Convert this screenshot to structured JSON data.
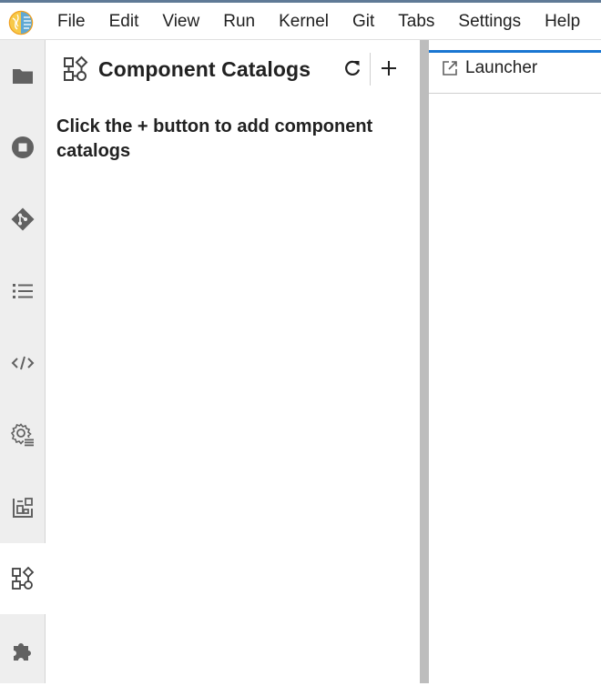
{
  "menu": {
    "items": [
      {
        "name": "menu-file",
        "label": "File"
      },
      {
        "name": "menu-edit",
        "label": "Edit"
      },
      {
        "name": "menu-view",
        "label": "View"
      },
      {
        "name": "menu-run",
        "label": "Run"
      },
      {
        "name": "menu-kernel",
        "label": "Kernel"
      },
      {
        "name": "menu-git",
        "label": "Git"
      },
      {
        "name": "menu-tabs",
        "label": "Tabs"
      },
      {
        "name": "menu-settings",
        "label": "Settings"
      },
      {
        "name": "menu-help",
        "label": "Help"
      }
    ]
  },
  "sidebar": {
    "items": [
      {
        "icon": "folder-icon",
        "active": false
      },
      {
        "icon": "stop-circle-icon",
        "active": false
      },
      {
        "icon": "git-icon",
        "active": false
      },
      {
        "icon": "list-icon",
        "active": false
      },
      {
        "icon": "code-icon",
        "active": false
      },
      {
        "icon": "runtime-settings-icon",
        "active": false
      },
      {
        "icon": "component-palette-icon",
        "active": false
      },
      {
        "icon": "component-catalogs-icon",
        "active": true
      },
      {
        "icon": "puzzle-icon",
        "active": false
      }
    ]
  },
  "panel": {
    "title": "Component Catalogs",
    "empty_message": "Click the + button to add component catalogs",
    "icons": {
      "refresh": "refresh-icon",
      "add": "add-icon"
    }
  },
  "main": {
    "tab_label": "Launcher",
    "tab_icon": "launch-icon"
  },
  "colors": {
    "active_tab_accent": "#1976d2",
    "activity_bar_bg": "#eeeeee",
    "splitter": "#bdbdbd",
    "icon": "#616161"
  }
}
